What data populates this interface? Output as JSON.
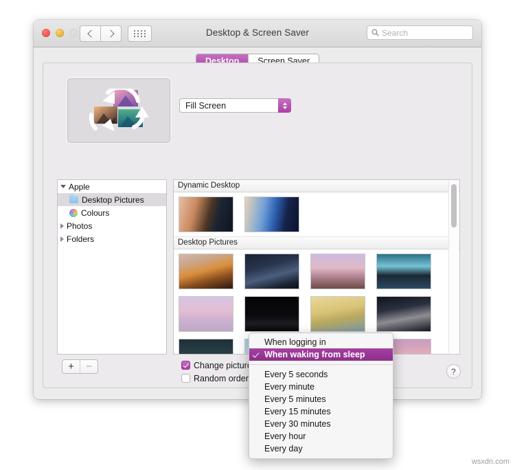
{
  "window": {
    "title": "Desktop & Screen Saver",
    "traffic_lights": [
      "close",
      "minimize",
      "zoom"
    ],
    "nav": {
      "back_icon": "chevron-left-icon",
      "forward_icon": "chevron-right-icon",
      "grid_icon": "show-all-grid-icon"
    },
    "search": {
      "placeholder": "Search",
      "value": "",
      "icon": "search-icon"
    }
  },
  "tabs": [
    {
      "label": "Desktop",
      "active": true
    },
    {
      "label": "Screen Saver",
      "active": false
    }
  ],
  "preview": {
    "icon": "rotating-pictures-icon",
    "alt": "Desktop picture rotation preview"
  },
  "fill_popup": {
    "value": "Fill Screen",
    "arrow_icon": "updown-arrows-icon"
  },
  "sidebar": {
    "items": [
      {
        "label": "Apple",
        "level": 0,
        "disclosure": "down",
        "icon": null,
        "selected": false
      },
      {
        "label": "Desktop Pictures",
        "level": 1,
        "disclosure": null,
        "icon": "blue-folder-icon",
        "selected": true
      },
      {
        "label": "Colours",
        "level": 1,
        "disclosure": null,
        "icon": "colour-wheel-icon",
        "selected": false
      },
      {
        "label": "Photos",
        "level": 0,
        "disclosure": "right",
        "icon": null,
        "selected": false
      },
      {
        "label": "Folders",
        "level": 0,
        "disclosure": "right",
        "icon": null,
        "selected": false
      }
    ],
    "add_button": "+",
    "remove_button": "−"
  },
  "wallpaper_groups": [
    {
      "header": "Dynamic Desktop",
      "thumbs": [
        {
          "name": "mojave-dynamic",
          "css": "linear-gradient(105deg,#e8bfa4 0%,#c9885f 30%,#4a3524 55%,#1d2433 70%,#0d1522 100%)"
        },
        {
          "name": "solar-gradients-dynamic",
          "css": "linear-gradient(100deg,#e8d6b8 0%,#6f9fd8 35%,#2d5fb0 55%,#16224a 75%,#0c1330 100%)"
        }
      ]
    },
    {
      "header": "Desktop Pictures",
      "thumbs": [
        {
          "name": "mojave-day",
          "css": "linear-gradient(165deg,#d7b6a6 0%,#c9a88f 22%,#d98f3c 48%,#8c4f20 70%,#2b1a10 100%)"
        },
        {
          "name": "mojave-night",
          "css": "linear-gradient(165deg,#1b2434 0%,#28344c 35%,#4b5e7d 60%,#1a2230 85%,#0d121c 100%)"
        },
        {
          "name": "desert-rock-dusk",
          "css": "linear-gradient(180deg,#cdbbe0 0%,#e0b9c4 40%,#b8899a 62%,#6e4a46 100%)"
        },
        {
          "name": "salt-flat-blue",
          "css": "linear-gradient(180deg,#2d6f86 0%,#74c3d4 35%,#1c2733 62%,#2a4b63 100%)"
        },
        {
          "name": "pink-salt-lake",
          "css": "linear-gradient(180deg,#d6c4e4 0%,#e3bfd2 40%,#cbb0cf 70%,#bfa9c6 100%)"
        },
        {
          "name": "mono-lake-night",
          "css": "linear-gradient(180deg,#060608 0%,#0b0b0e 55%,#1d1d22 78%,#070709 100%)"
        },
        {
          "name": "sand-dunes-day",
          "css": "linear-gradient(170deg,#e8d89a 0%,#d9c377 40%,#b9a95f 62%,#7d9aa6 100%)"
        },
        {
          "name": "sand-dune-night",
          "css": "linear-gradient(170deg,#11141f 0%,#2b3040 35%,#8d8d92 62%,#15171f 100%)"
        },
        {
          "name": "dark-mountain-lake",
          "css": "linear-gradient(180deg,#1d3038 0%,#2a4049 45%,#101a20 100%)"
        },
        {
          "name": "blue-sky-cloud",
          "css": "linear-gradient(180deg,#a9cde8 0%,#cfe2f0 55%,#e4edf4 100%)"
        },
        {
          "name": "coral-sunset",
          "css": "linear-gradient(180deg,#e8705c 0%,#ef8a6a 45%,#d9746a 100%)"
        },
        {
          "name": "violet-sunset-cloud",
          "css": "linear-gradient(180deg,#c99cc2 0%,#e4b0b8 50%,#d79aa8 100%)"
        }
      ]
    }
  ],
  "options": [
    {
      "label": "Change picture:",
      "checked": true,
      "name": "change-picture"
    },
    {
      "label": "Random order",
      "checked": false,
      "name": "random-order"
    }
  ],
  "help_button": "?",
  "dropdown_menu": {
    "group_a": [
      {
        "label": "When logging in",
        "checked": false
      },
      {
        "label": "When waking from sleep",
        "checked": true
      }
    ],
    "group_b": [
      {
        "label": "Every 5 seconds",
        "checked": false
      },
      {
        "label": "Every minute",
        "checked": false
      },
      {
        "label": "Every 5 minutes",
        "checked": false
      },
      {
        "label": "Every 15 minutes",
        "checked": false
      },
      {
        "label": "Every 30 minutes",
        "checked": false
      },
      {
        "label": "Every hour",
        "checked": false
      },
      {
        "label": "Every day",
        "checked": false
      }
    ]
  },
  "watermark": "wsxdn.com",
  "colors": {
    "accent_purple": "#ab3fa6",
    "menu_highlight": "#8d2f8a",
    "window_bg": "#ececec",
    "panel_bg": "#eceaec"
  }
}
